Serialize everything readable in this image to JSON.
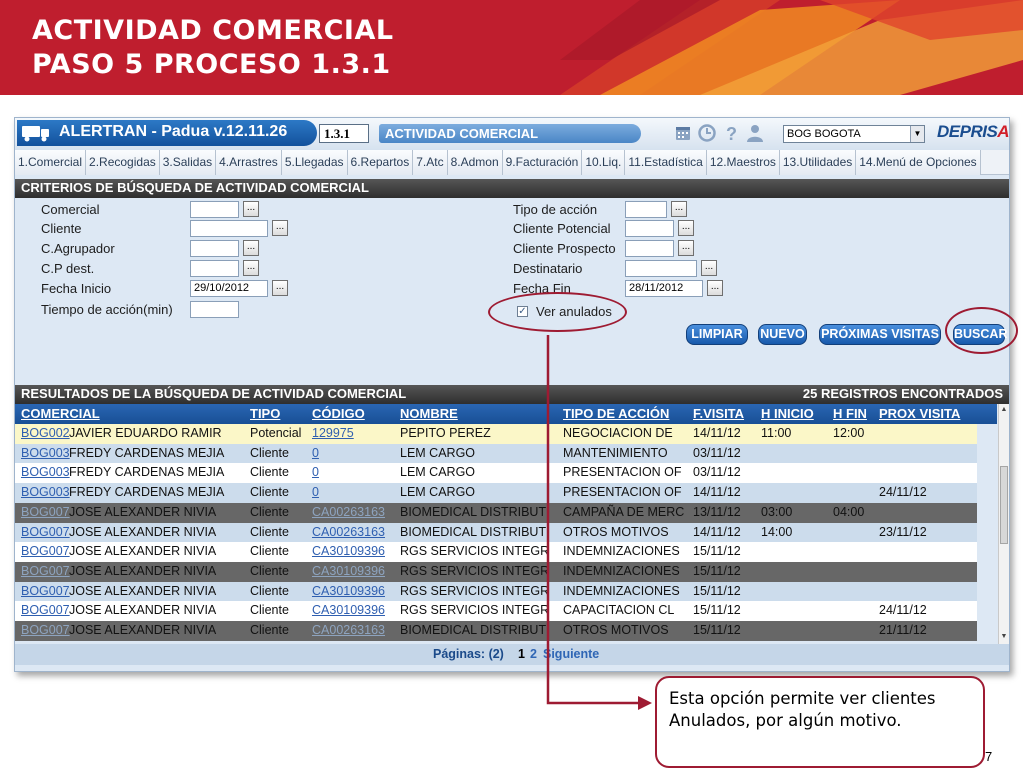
{
  "slide": {
    "title_line1": "ACTIVIDAD COMERCIAL",
    "title_line2": "PASO 5 PROCESO 1.3.1",
    "callout_line1": "Esta opción permite ver clientes",
    "callout_line2": "Anulados, por algún motivo.",
    "page_number": "7",
    "accent_color": "#9e1b32",
    "header_color": "#bf1e2e"
  },
  "app": {
    "title": "ALERTRAN - Padua  v.12.11.26",
    "screen_code": "1.3.1",
    "screen_title": "ACTIVIDAD COMERCIAL",
    "branch": "BOG BOGOTA",
    "logo": "DEPRIS",
    "logo_tail": "A",
    "toolbar_icons": [
      "calendar-icon",
      "clock-icon",
      "help-icon",
      "user-icon"
    ]
  },
  "menu": [
    "1.Comercial",
    "2.Recogidas",
    "3.Salidas",
    "4.Arrastres",
    "5.Llegadas",
    "6.Repartos",
    "7.Atc",
    "8.Admon",
    "9.Facturación",
    "10.Liq.",
    "11.Estadística",
    "12.Maestros",
    "13.Utilidades",
    "14.Menú de Opciones"
  ],
  "criteria": {
    "header": "CRITERIOS DE BÚSQUEDA DE ACTIVIDAD COMERCIAL",
    "comercial": "Comercial",
    "cliente": "Cliente",
    "agrupador": "C.Agrupador",
    "cp_dest": "C.P dest.",
    "fecha_inicio": "Fecha Inicio",
    "fecha_inicio_value": "29/10/2012",
    "tiempo": "Tiempo de acción(min)",
    "tipo_accion": "Tipo de acción",
    "cliente_potencial": "Cliente Potencial",
    "cliente_prospecto": "Cliente Prospecto",
    "destinatario": "Destinatario",
    "fecha_fin": "Fecha Fin",
    "fecha_fin_value": "28/11/2012",
    "ver_anulados": "Ver anulados",
    "ver_anulados_checked": true,
    "lookup": "..."
  },
  "actions": {
    "limpiar": "LIMPIAR",
    "nuevo": "NUEVO",
    "proximas": "PRÓXIMAS VISITAS",
    "buscar": "BUSCAR"
  },
  "results": {
    "header": "RESULTADOS DE LA BÚSQUEDA DE ACTIVIDAD COMERCIAL",
    "count": "25 REGISTROS ENCONTRADOS",
    "columns": [
      "COMERCIAL",
      "TIPO",
      "CÓDIGO",
      "NOMBRE",
      "TIPO DE ACCIÓN",
      "F.VISITA",
      "H INICIO",
      "H FIN",
      "PROX VISITA"
    ],
    "rows": [
      {
        "code": "BOG002",
        "name": "JAVIER EDUARDO RAMIR",
        "tipo": "Potencial",
        "codigo": "129975",
        "nombre": "PEPITO PEREZ",
        "accion": "NEGOCIACION DE",
        "fvisita": "14/11/12",
        "hinicio": "11:00",
        "hfin": "12:00",
        "prox": ""
      },
      {
        "code": "BOG003",
        "name": "FREDY CARDENAS MEJIA",
        "tipo": "Cliente",
        "codigo": "0",
        "nombre": "LEM CARGO",
        "accion": "MANTENIMIENTO",
        "fvisita": "03/11/12",
        "hinicio": "",
        "hfin": "",
        "prox": ""
      },
      {
        "code": "BOG003",
        "name": "FREDY CARDENAS MEJIA",
        "tipo": "Cliente",
        "codigo": "0",
        "nombre": "LEM CARGO",
        "accion": "PRESENTACION OF",
        "fvisita": "03/11/12",
        "hinicio": "",
        "hfin": "",
        "prox": ""
      },
      {
        "code": "BOG003",
        "name": "FREDY CARDENAS MEJIA",
        "tipo": "Cliente",
        "codigo": "0",
        "nombre": "LEM CARGO",
        "accion": "PRESENTACION OF",
        "fvisita": "14/11/12",
        "hinicio": "",
        "hfin": "",
        "prox": "24/11/12"
      },
      {
        "code": "BOG007",
        "name": "JOSE ALEXANDER NIVIA",
        "tipo": "Cliente",
        "codigo": "CA00263163",
        "nombre": "BIOMEDICAL DISTRIBUT",
        "accion": "CAMPAÑA DE MERC",
        "fvisita": "13/11/12",
        "hinicio": "03:00",
        "hfin": "04:00",
        "prox": ""
      },
      {
        "code": "BOG007",
        "name": "JOSE ALEXANDER NIVIA",
        "tipo": "Cliente",
        "codigo": "CA00263163",
        "nombre": "BIOMEDICAL DISTRIBUT",
        "accion": "OTROS MOTIVOS",
        "fvisita": "14/11/12",
        "hinicio": "14:00",
        "hfin": "",
        "prox": "23/11/12"
      },
      {
        "code": "BOG007",
        "name": "JOSE ALEXANDER NIVIA",
        "tipo": "Cliente",
        "codigo": "CA30109396",
        "nombre": "RGS SERVICIOS INTEGR",
        "accion": "INDEMNIZACIONES",
        "fvisita": "15/11/12",
        "hinicio": "",
        "hfin": "",
        "prox": ""
      },
      {
        "code": "BOG007",
        "name": "JOSE ALEXANDER NIVIA",
        "tipo": "Cliente",
        "codigo": "CA30109396",
        "nombre": "RGS SERVICIOS INTEGR",
        "accion": "INDEMNIZACIONES",
        "fvisita": "15/11/12",
        "hinicio": "",
        "hfin": "",
        "prox": ""
      },
      {
        "code": "BOG007",
        "name": "JOSE ALEXANDER NIVIA",
        "tipo": "Cliente",
        "codigo": "CA30109396",
        "nombre": "RGS SERVICIOS INTEGR",
        "accion": "INDEMNIZACIONES",
        "fvisita": "15/11/12",
        "hinicio": "",
        "hfin": "",
        "prox": ""
      },
      {
        "code": "BOG007",
        "name": "JOSE ALEXANDER NIVIA",
        "tipo": "Cliente",
        "codigo": "CA30109396",
        "nombre": "RGS SERVICIOS INTEGR",
        "accion": "CAPACITACION CL",
        "fvisita": "15/11/12",
        "hinicio": "",
        "hfin": "",
        "prox": "24/11/12"
      },
      {
        "code": "BOG007",
        "name": "JOSE ALEXANDER NIVIA",
        "tipo": "Cliente",
        "codigo": "CA00263163",
        "nombre": "BIOMEDICAL DISTRIBUT",
        "accion": "OTROS MOTIVOS",
        "fvisita": "15/11/12",
        "hinicio": "",
        "hfin": "",
        "prox": "21/11/12"
      }
    ]
  },
  "pager": {
    "label": "Páginas: (2)",
    "current": "1",
    "next_page": "2",
    "next": "Siguiente"
  }
}
